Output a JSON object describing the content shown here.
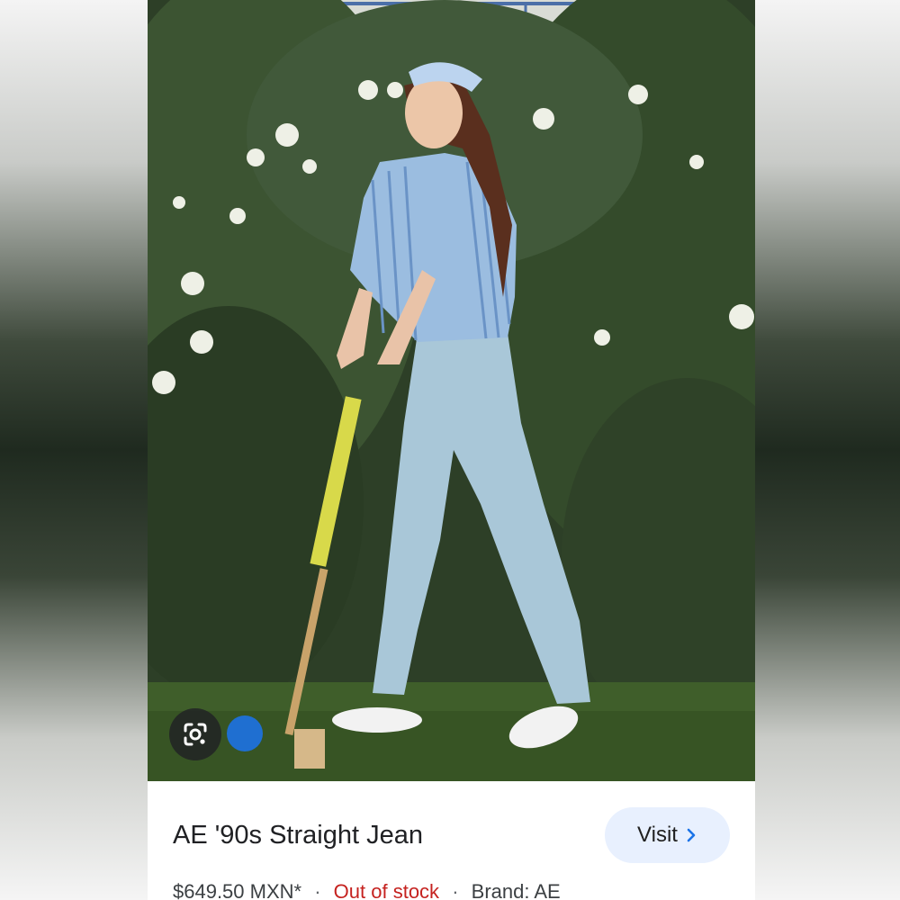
{
  "product": {
    "title": "AE '90s Straight Jean",
    "price": "$649.50 MXN*",
    "stock_status": "Out of stock",
    "brand": "Brand: AE",
    "separator": "·"
  },
  "actions": {
    "visit_label": "Visit",
    "visit_icon": "chevron-right-icon",
    "lens_icon": "google-lens-icon"
  },
  "colors": {
    "stock_status": "#c5221f",
    "visit_button_bg": "#e8f0fe"
  }
}
